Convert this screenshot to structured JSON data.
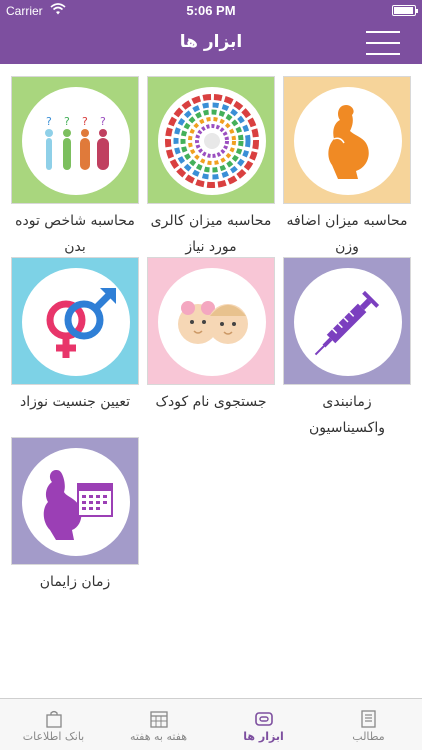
{
  "status": {
    "carrier": "Carrier",
    "time": "5:06 PM",
    "battery_level": 0.95
  },
  "header": {
    "title": "ابزار ها",
    "menu_icon": "hamburger-menu-icon"
  },
  "tools": [
    {
      "label": "محاسبه میزان اضافه وزن",
      "icon": "pregnant-silhouette-icon",
      "bg": "#f6d49a"
    },
    {
      "label": "محاسبه میزان کالری مورد نیاز",
      "icon": "calorie-wheel-icon",
      "bg": "#a9d67e"
    },
    {
      "label": "محاسبه شاخص توده بدن",
      "icon": "bmi-figures-icon",
      "bg": "#a9d67e"
    },
    {
      "label": "زمانبندی واکسیناسیون",
      "icon": "syringe-icon",
      "bg": "#a39bc9"
    },
    {
      "label": "جستجوی نام کودک",
      "icon": "baby-faces-icon",
      "bg": "#f8c6d6"
    },
    {
      "label": "تعیین جنسیت نوزاد",
      "icon": "gender-symbols-icon",
      "bg": "#7dd2e6"
    },
    {
      "label": "زمان زایمان",
      "icon": "pregnant-calendar-icon",
      "bg": "#a39bc9"
    }
  ],
  "tabs": [
    {
      "label": "مطالب",
      "icon": "articles-icon",
      "active": false
    },
    {
      "label": "ابزار ها",
      "icon": "tools-icon",
      "active": true
    },
    {
      "label": "هفته به هفته",
      "icon": "calendar-grid-icon",
      "active": false
    },
    {
      "label": "بانک اطلاعات",
      "icon": "shopping-bag-icon",
      "active": false
    }
  ],
  "colors": {
    "brand": "#7d4f9f",
    "tab_inactive": "#888888"
  }
}
